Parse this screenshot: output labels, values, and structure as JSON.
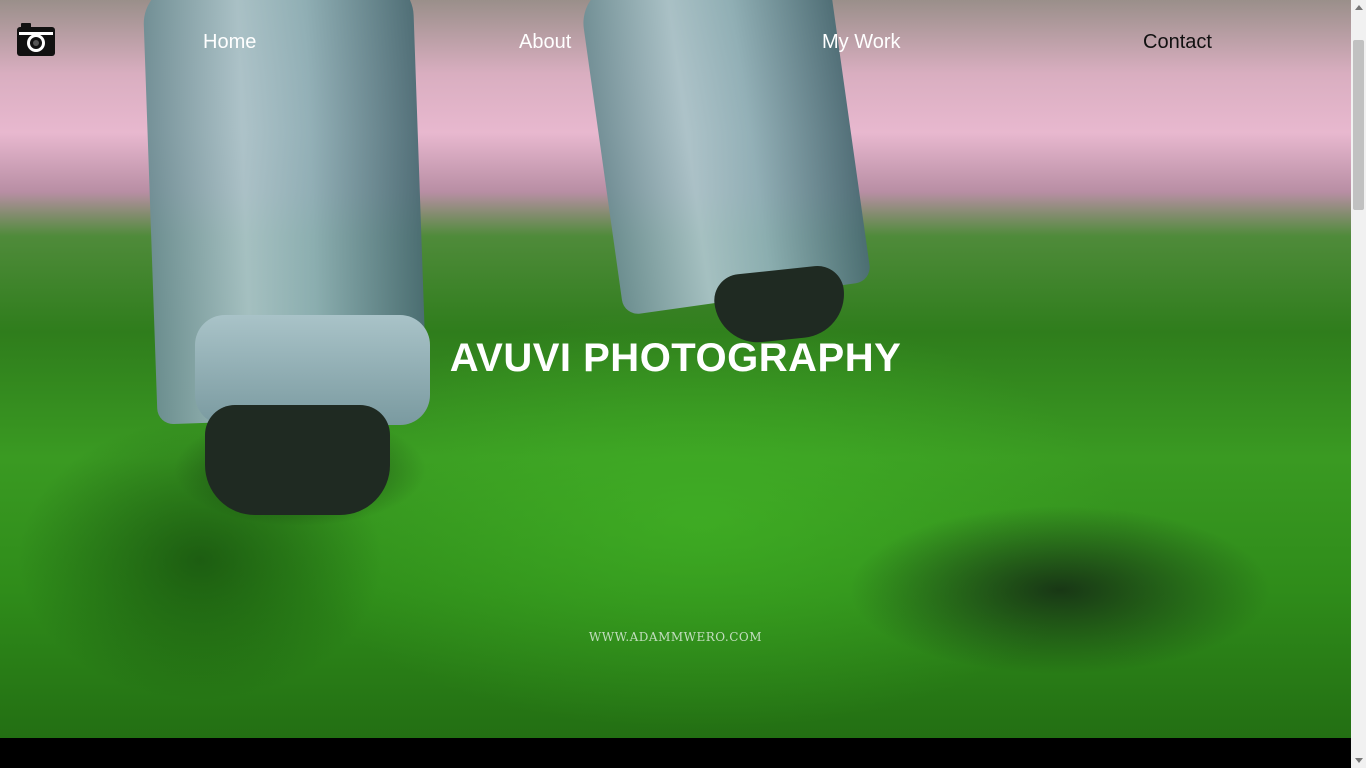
{
  "nav": {
    "logo_icon": "camera-icon",
    "items": [
      {
        "label": "Home"
      },
      {
        "label": "About"
      },
      {
        "label": "My Work"
      },
      {
        "label": "Contact"
      }
    ]
  },
  "hero": {
    "title": "AVUVI PHOTOGRAPHY",
    "site_url": "WWW.ADAMMWERO.COM"
  },
  "colors": {
    "text": "#ffffff",
    "contact_text": "#111111",
    "footer": "#000000"
  }
}
